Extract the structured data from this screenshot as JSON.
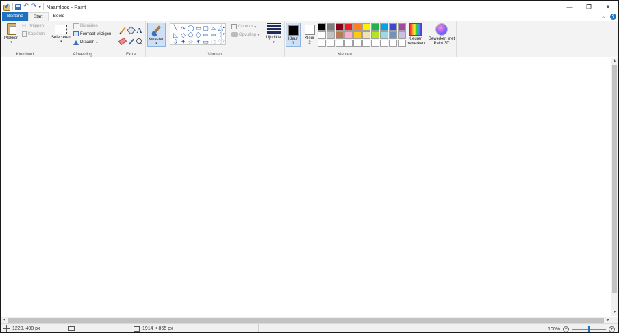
{
  "window": {
    "title": "Naamloos - Paint",
    "minimize": "—",
    "maximize": "❐",
    "close": "✕"
  },
  "tabs": [
    {
      "label": "Bestand"
    },
    {
      "label": "Start"
    },
    {
      "label": "Beeld"
    }
  ],
  "help": "?",
  "ribbon": {
    "clipboard": {
      "group_label": "Klembord",
      "paste": "Plakken",
      "cut": "Knippen",
      "copy": "Kopiëren"
    },
    "image": {
      "group_label": "Afbeelding",
      "select": "Selecteren",
      "crop": "Bijsnijden",
      "resize": "Formaat wijzigen",
      "rotate": "Draaien"
    },
    "tools": {
      "group_label": "Extra",
      "text_glyph": "A"
    },
    "brushes": {
      "label": "Kwasten"
    },
    "shapes": {
      "group_label": "Vormen",
      "outline": "Contour",
      "fill": "Opvulling",
      "glyphs": [
        "╲",
        "∿",
        "◯",
        "▭",
        "▢",
        "⌓",
        "△",
        "◺",
        "◇",
        "⬠",
        "⬡",
        "⇨",
        "⇦",
        "⇧",
        "⇩",
        "✦",
        "☆",
        "✶",
        "▭",
        "◌",
        "♡"
      ]
    },
    "size": {
      "label": "Lijndikte"
    },
    "colors": {
      "group_label": "Kleuren",
      "color1_label": "Kleur 1",
      "color2_label": "Kleur 2",
      "color1": "#000000",
      "color2": "#ffffff",
      "edit_colors": "Kleuren bewerken",
      "paint3d": "Bewerken met Paint 3D",
      "palette": [
        "#000000",
        "#7f7f7f",
        "#880015",
        "#ed1c24",
        "#ff7f27",
        "#fff200",
        "#22b14c",
        "#00a2e8",
        "#3f48cc",
        "#a349a4",
        "#ffffff",
        "#c3c3c3",
        "#b97a57",
        "#ffaec9",
        "#ffc90e",
        "#efe4b0",
        "#b5e61d",
        "#99d9ea",
        "#7092be",
        "#c8bfe7",
        "#ffffff",
        "#ffffff",
        "#ffffff",
        "#ffffff",
        "#ffffff",
        "#ffffff",
        "#ffffff",
        "#ffffff",
        "#ffffff",
        "#ffffff"
      ]
    }
  },
  "status": {
    "cursor_position": "1220, 408 px",
    "canvas_size": "1914 × 855 px",
    "zoom": "100%"
  }
}
